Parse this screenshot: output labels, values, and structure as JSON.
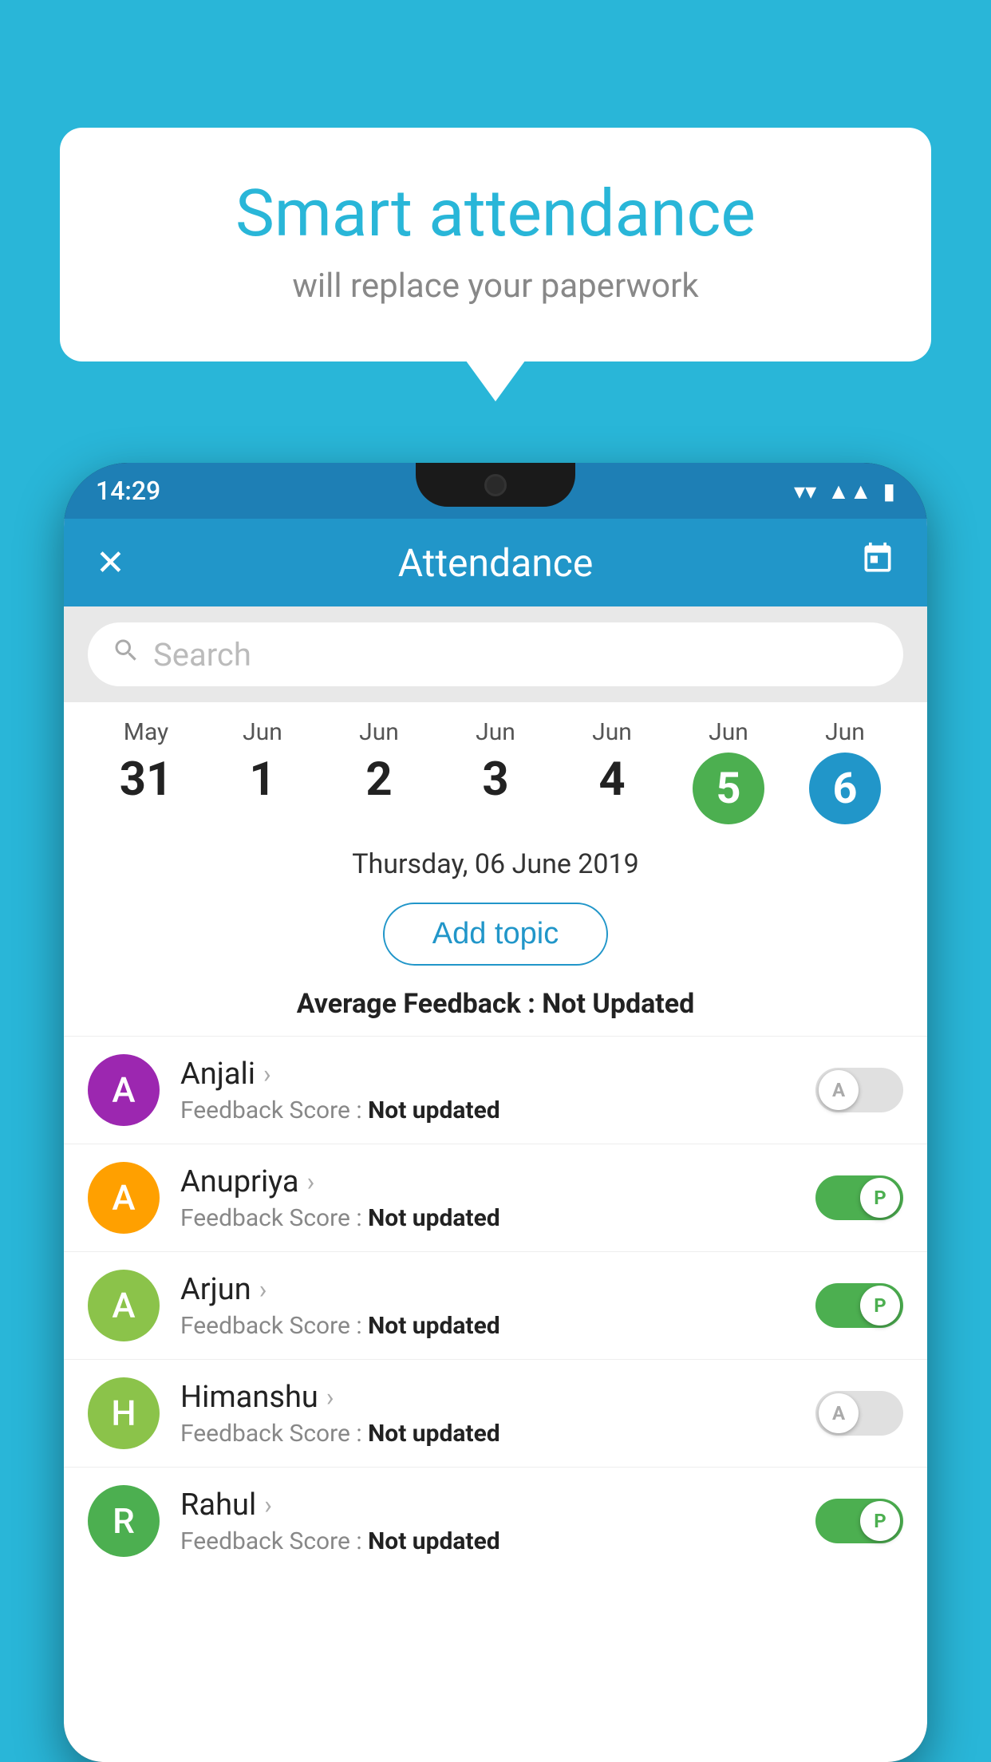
{
  "background_color": "#29b6d8",
  "speech_bubble": {
    "title": "Smart attendance",
    "subtitle": "will replace your paperwork"
  },
  "status_bar": {
    "time": "14:29",
    "wifi": "▾",
    "signal": "▲",
    "battery": "▮"
  },
  "app_header": {
    "title": "Attendance",
    "close_label": "✕",
    "calendar_label": "📅"
  },
  "search": {
    "placeholder": "Search"
  },
  "dates": [
    {
      "month": "May",
      "day": "31",
      "active": false
    },
    {
      "month": "Jun",
      "day": "1",
      "active": false
    },
    {
      "month": "Jun",
      "day": "2",
      "active": false
    },
    {
      "month": "Jun",
      "day": "3",
      "active": false
    },
    {
      "month": "Jun",
      "day": "4",
      "active": false
    },
    {
      "month": "Jun",
      "day": "5",
      "active": "green"
    },
    {
      "month": "Jun",
      "day": "6",
      "active": "blue"
    }
  ],
  "selected_date": "Thursday, 06 June 2019",
  "add_topic_label": "Add topic",
  "average_feedback": {
    "label": "Average Feedback : ",
    "value": "Not Updated"
  },
  "students": [
    {
      "name": "Anjali",
      "avatar_letter": "A",
      "avatar_color": "#9C27B0",
      "feedback_label": "Feedback Score : ",
      "feedback_value": "Not updated",
      "toggle_state": "off",
      "toggle_label": "A"
    },
    {
      "name": "Anupriya",
      "avatar_letter": "A",
      "avatar_color": "#FFA000",
      "feedback_label": "Feedback Score : ",
      "feedback_value": "Not updated",
      "toggle_state": "on",
      "toggle_label": "P"
    },
    {
      "name": "Arjun",
      "avatar_letter": "A",
      "avatar_color": "#8BC34A",
      "feedback_label": "Feedback Score : ",
      "feedback_value": "Not updated",
      "toggle_state": "on",
      "toggle_label": "P"
    },
    {
      "name": "Himanshu",
      "avatar_letter": "H",
      "avatar_color": "#8BC34A",
      "feedback_label": "Feedback Score : ",
      "feedback_value": "Not updated",
      "toggle_state": "off",
      "toggle_label": "A"
    },
    {
      "name": "Rahul",
      "avatar_letter": "R",
      "avatar_color": "#4CAF50",
      "feedback_label": "Feedback Score : ",
      "feedback_value": "Not updated",
      "toggle_state": "on",
      "toggle_label": "P"
    }
  ]
}
